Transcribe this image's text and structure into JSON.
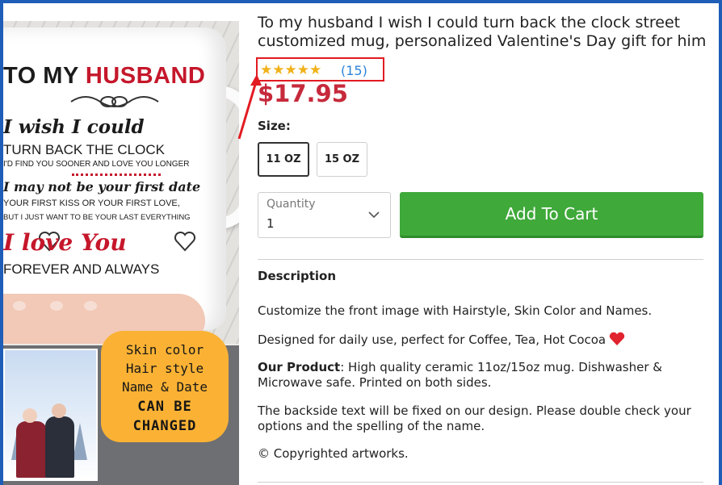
{
  "product": {
    "title": "To my husband I wish I could turn back the clock street customized mug, personalized Valentine's Day gift for him",
    "stars": "★★★★★",
    "rating_value": 5,
    "review_count": "(15)",
    "price": "$17.95"
  },
  "image": {
    "mug_title_plain": "TO MY ",
    "mug_title_red": "HUSBAND",
    "line1": "I wish I could",
    "line2": "TURN BACK THE CLOCK",
    "line3": "I'D FIND YOU SOONER AND LOVE YOU LONGER",
    "line4": "I may not be your first date",
    "line5": "YOUR FIRST KISS OR YOUR FIRST LOVE,",
    "line6": "BUT I JUST WANT TO BE YOUR LAST EVERYTHING",
    "line7": "I love You",
    "line8": "FOREVER AND ALWAYS",
    "badge": [
      "Skin color",
      "Hair style",
      "Name & Date",
      "CAN BE",
      "CHANGED"
    ]
  },
  "options": {
    "size_label": "Size:",
    "sizes": [
      "11 OZ",
      "15 OZ"
    ],
    "selected_size": "11 OZ"
  },
  "quantity": {
    "label": "Quantity",
    "value": "1"
  },
  "cart": {
    "label": "Add To Cart"
  },
  "description": {
    "heading": "Description",
    "p1": "Customize the front image with Hairstyle, Skin Color and Names.",
    "p2": "Designed for daily use, perfect for Coffee, Tea, Hot Cocoa",
    "p3_bold": "Our Product",
    "p3_rest": ": High quality ceramic 11oz/15oz mug. Dishwasher & Microwave safe. Printed on both sides.",
    "p4": "The backside text will be fixed on our design. Please double check your options and the spelling of the name.",
    "p5": "© Copyrighted artworks."
  },
  "colors": {
    "price": "#c62a3b",
    "star": "#f0b21a",
    "link": "#2b84d6",
    "cart_button": "#3fa93a",
    "highlight_box": "#e21b22",
    "badge": "#fbb234"
  }
}
